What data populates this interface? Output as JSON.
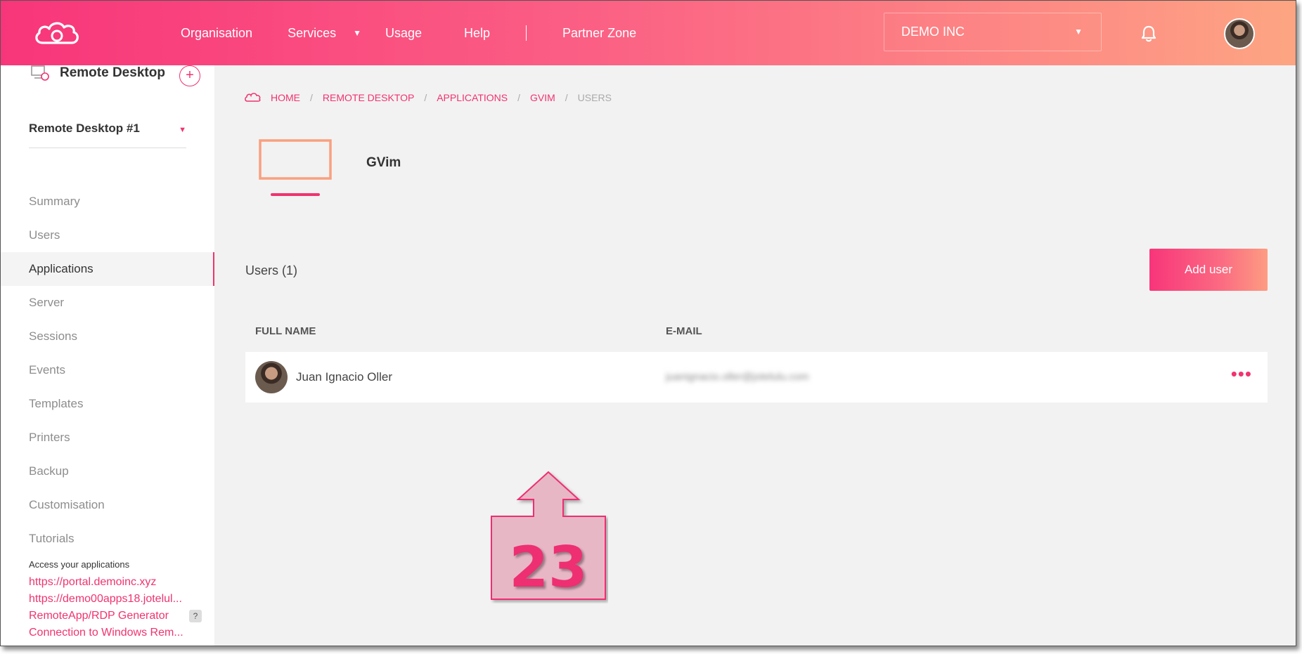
{
  "nav": {
    "items": [
      "Organisation",
      "Services",
      "Usage",
      "Help",
      "Partner Zone"
    ],
    "org_select": "DEMO INC"
  },
  "sidebar": {
    "title": "Remote Desktop",
    "selector": "Remote Desktop #1",
    "menu": [
      "Summary",
      "Users",
      "Applications",
      "Server",
      "Sessions",
      "Events",
      "Templates",
      "Printers",
      "Backup",
      "Customisation",
      "Tutorials"
    ],
    "active": "Applications",
    "access_label": "Access your applications",
    "links": [
      "https://portal.demoinc.xyz",
      "https://demo00apps18.jotelul...",
      "RemoteApp/RDP Generator",
      "Connection to Windows Rem..."
    ],
    "help_badge": "?"
  },
  "breadcrumb": [
    "HOME",
    "REMOTE DESKTOP",
    "APPLICATIONS",
    "GVIM",
    "USERS"
  ],
  "app": {
    "name": "GVim"
  },
  "users": {
    "count_label": "Users (1)",
    "add_button": "Add user",
    "columns": {
      "name": "FULL NAME",
      "email": "E-MAIL"
    },
    "rows": [
      {
        "name": "Juan Ignacio Oller",
        "email": "juanignacio.oller@jotelulu.com",
        "menu": "•••"
      }
    ]
  },
  "annotation": {
    "number": "23"
  },
  "colors": {
    "accent": "#f0336f",
    "gradient_start": "#f8357a",
    "gradient_end": "#fda583"
  }
}
